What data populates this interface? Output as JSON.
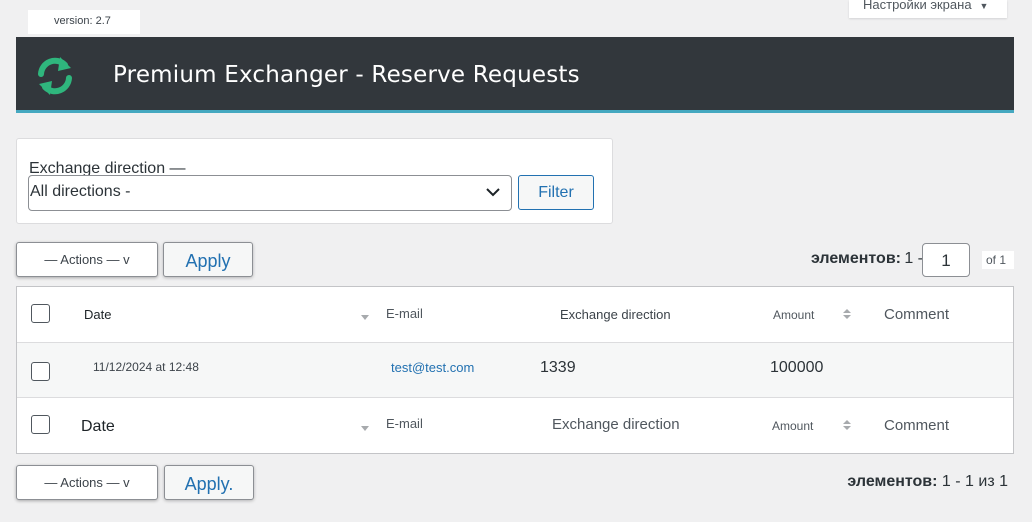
{
  "version": "version: 2.7",
  "screen_options": "Настройки экрана",
  "banner": {
    "title": "Premium Exchanger - Reserve Requests",
    "accent": "#45a8c0",
    "logo_color": "#2fb67d"
  },
  "filter": {
    "label": "Exchange direction —",
    "selected": "All directions -",
    "button": "Filter"
  },
  "bulk_top": {
    "actions": "— Actions — v",
    "apply": "Apply"
  },
  "bulk_bottom": {
    "actions": "— Actions — v",
    "apply": "Apply."
  },
  "pager_top": {
    "label": "элементов:",
    "range": "1 -",
    "page": "1",
    "of": "of 1"
  },
  "pager_bottom": {
    "label": "элементов:",
    "text": "1 - 1 из 1"
  },
  "table": {
    "header": {
      "date": "Date",
      "email": "E-mail",
      "direction": "Exchange direction",
      "amount": "Amount",
      "comment": "Comment"
    },
    "rows": [
      {
        "date": "11/12/2024 at 12:48",
        "email": "test@test.com",
        "direction": "1339",
        "amount": "100000",
        "comment": ""
      }
    ],
    "footer": {
      "date": "Date",
      "email": "E-mail",
      "direction": "Exchange direction",
      "amount": "Amount",
      "comment": "Comment"
    }
  }
}
